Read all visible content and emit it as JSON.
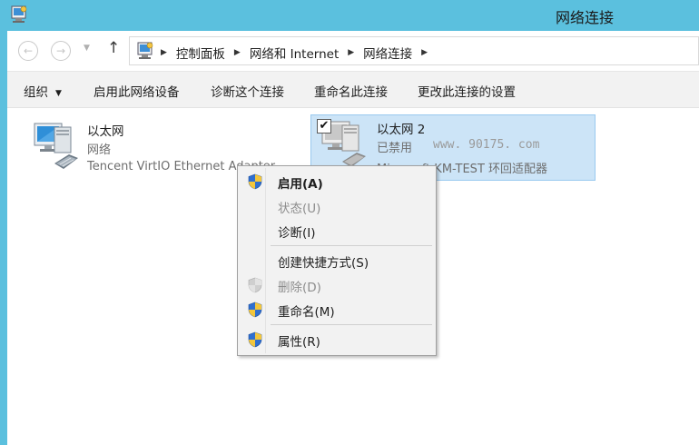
{
  "window": {
    "title": "网络连接",
    "frame_color": "#5bc0de"
  },
  "nav": {
    "back_icon": "back-arrow-icon",
    "forward_icon": "forward-arrow-icon",
    "recent_icon": "chevron-down-icon",
    "up_icon": "up-arrow-icon",
    "breadcrumb": [
      "控制面板",
      "网络和 Internet",
      "网络连接"
    ]
  },
  "toolbar": {
    "organize": "组织",
    "enable": "启用此网络设备",
    "diagnose": "诊断这个连接",
    "rename": "重命名此连接",
    "settings": "更改此连接的设置"
  },
  "connections": [
    {
      "name": "以太网",
      "status": "网络",
      "adapter": "Tencent VirtIO Ethernet Adapter",
      "selected": false
    },
    {
      "name": "以太网 2",
      "status": "已禁用",
      "adapter": "Microsoft KM-TEST 环回适配器",
      "selected": true,
      "checked": true
    }
  ],
  "watermark": "www. 90175. com",
  "context_menu": {
    "items": [
      {
        "label": "启用(A)",
        "bold": true,
        "disabled": false,
        "icon": "uac-shield-icon"
      },
      {
        "label": "状态(U)",
        "bold": false,
        "disabled": true,
        "icon": ""
      },
      {
        "label": "诊断(I)",
        "bold": false,
        "disabled": false,
        "icon": ""
      },
      {
        "label": "创建快捷方式(S)",
        "bold": false,
        "disabled": false,
        "icon": ""
      },
      {
        "label": "删除(D)",
        "bold": false,
        "disabled": true,
        "icon": "uac-shield-icon"
      },
      {
        "label": "重命名(M)",
        "bold": false,
        "disabled": false,
        "icon": "uac-shield-icon"
      },
      {
        "label": "属性(R)",
        "bold": false,
        "disabled": false,
        "icon": "uac-shield-icon"
      }
    ]
  }
}
